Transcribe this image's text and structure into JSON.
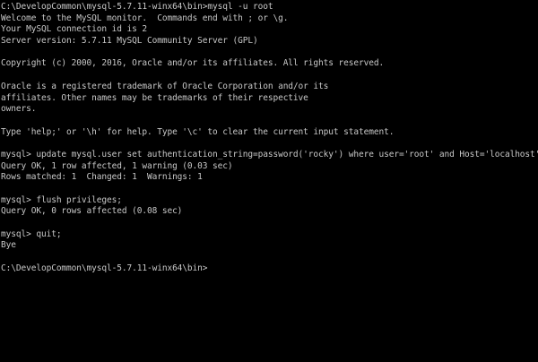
{
  "terminal": {
    "lines": [
      "C:\\DevelopCommon\\mysql-5.7.11-winx64\\bin>mysql -u root",
      "Welcome to the MySQL monitor.  Commands end with ; or \\g.",
      "Your MySQL connection id is 2",
      "Server version: 5.7.11 MySQL Community Server (GPL)",
      "",
      "Copyright (c) 2000, 2016, Oracle and/or its affiliates. All rights reserved.",
      "",
      "Oracle is a registered trademark of Oracle Corporation and/or its",
      "affiliates. Other names may be trademarks of their respective",
      "owners.",
      "",
      "Type 'help;' or '\\h' for help. Type '\\c' to clear the current input statement.",
      "",
      "mysql> update mysql.user set authentication_string=password('rocky') where user='root' and Host='localhost';",
      "Query OK, 1 row affected, 1 warning (0.03 sec)",
      "Rows matched: 1  Changed: 1  Warnings: 1",
      "",
      "mysql> flush privileges;",
      "Query OK, 0 rows affected (0.08 sec)",
      "",
      "mysql> quit;",
      "Bye",
      "",
      "C:\\DevelopCommon\\mysql-5.7.11-winx64\\bin>"
    ]
  }
}
